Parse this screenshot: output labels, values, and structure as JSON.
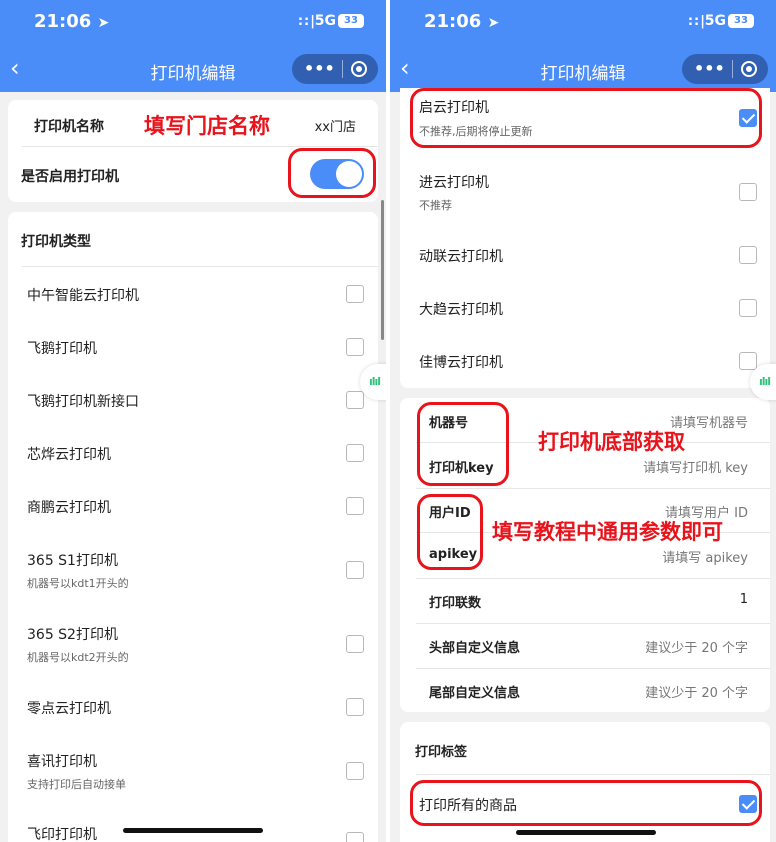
{
  "status_bar": {
    "time": "21:06",
    "location_arrow": "➤",
    "signal": "::|",
    "network": "5G",
    "battery": "33"
  },
  "nav": {
    "back_icon": "‹",
    "title": "打印机编辑",
    "more_icon": "•••"
  },
  "left": {
    "printer_name_label": "打印机名称",
    "printer_name_value": "xx门店",
    "enable_label": "是否启用打印机",
    "enable_on": true,
    "type_header": "打印机类型",
    "types": [
      {
        "name": "中午智能云打印机",
        "sub": "",
        "checked": false
      },
      {
        "name": "飞鹅打印机",
        "sub": "",
        "checked": false
      },
      {
        "name": "飞鹅打印机新接口",
        "sub": "",
        "checked": false
      },
      {
        "name": "芯烨云打印机",
        "sub": "",
        "checked": false
      },
      {
        "name": "商鹏云打印机",
        "sub": "",
        "checked": false
      },
      {
        "name": "365 S1打印机",
        "sub": "机器号以kdt1开头的",
        "checked": false
      },
      {
        "name": "365 S2打印机",
        "sub": "机器号以kdt2开头的",
        "checked": false
      },
      {
        "name": "零点云打印机",
        "sub": "",
        "checked": false
      },
      {
        "name": "喜讯打印机",
        "sub": "支持打印后自动接单",
        "checked": false
      },
      {
        "name": "飞印打印机",
        "sub": "",
        "checked": false
      }
    ],
    "annotation": "填写门店名称"
  },
  "right": {
    "types": [
      {
        "name": "启云打印机",
        "sub": "不推荐,后期将停止更新",
        "checked": true
      },
      {
        "name": "进云打印机",
        "sub": "不推荐",
        "checked": false
      },
      {
        "name": "动联云打印机",
        "sub": "",
        "checked": false
      },
      {
        "name": "大趋云打印机",
        "sub": "",
        "checked": false
      },
      {
        "name": "佳博云打印机",
        "sub": "",
        "checked": false
      }
    ],
    "fields": [
      {
        "label": "机器号",
        "placeholder": "请填写机器号"
      },
      {
        "label": "打印机key",
        "placeholder": "请填写打印机 key"
      },
      {
        "label": "用户ID",
        "placeholder": "请填写用户 ID"
      },
      {
        "label": "apikey",
        "placeholder": "请填写 apikey"
      },
      {
        "label": "打印联数",
        "placeholder": "1"
      },
      {
        "label": "头部自定义信息",
        "placeholder": "建议少于 20 个字"
      },
      {
        "label": "尾部自定义信息",
        "placeholder": "建议少于 20 个字"
      }
    ],
    "label_header": "打印标签",
    "print_all_label": "打印所有的商品",
    "print_all_checked": true,
    "annotation_machine": "打印机底部获取",
    "annotation_params": "填写教程中通用参数即可"
  },
  "colors": {
    "accent": "#4b8df8",
    "annotation": "#e8131b"
  },
  "icons": {
    "voice": "ılıl"
  }
}
